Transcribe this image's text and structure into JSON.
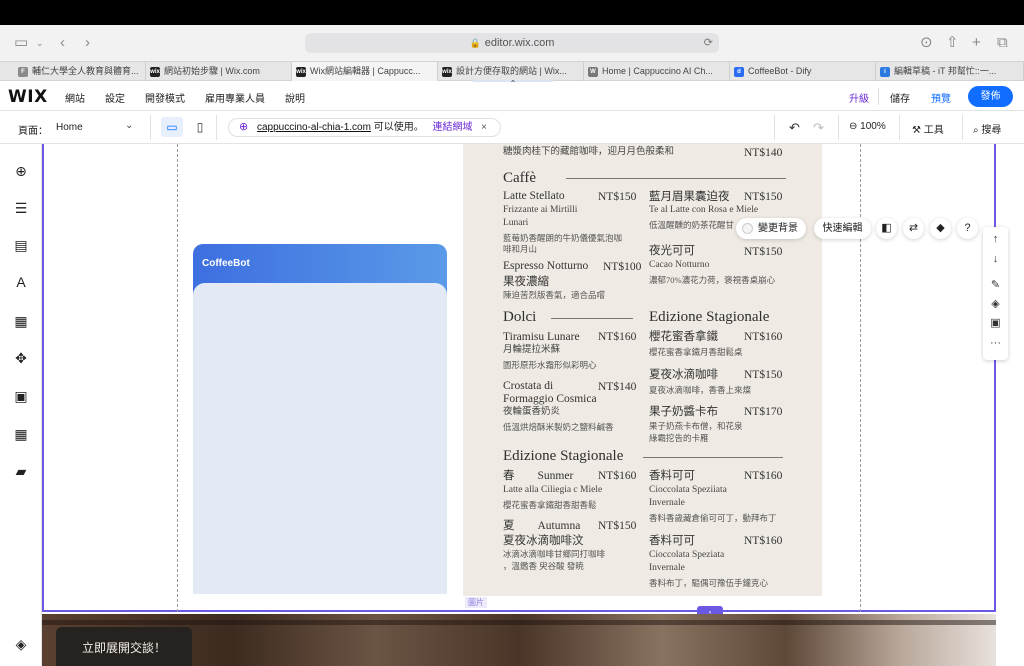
{
  "browser": {
    "url": "editor.wix.com",
    "tabs": [
      {
        "label": "輔仁大學全人教育與體育...",
        "fav": "F",
        "color": "#8a8a8a"
      },
      {
        "label": "網站初始步驟 | Wix.com",
        "fav": "wix",
        "color": "#222222"
      },
      {
        "label": "Wix網站編輯器 | Cappucc...",
        "fav": "wix",
        "color": "#222222"
      },
      {
        "label": "設計方便存取的網站 | Wix...",
        "fav": "wix",
        "color": "#222222"
      },
      {
        "label": "Home | Cappuccino AI Ch...",
        "fav": "W",
        "color": "#777777"
      },
      {
        "label": "CoffeeBot - Dify",
        "fav": "d",
        "color": "#2b6cf5"
      },
      {
        "label": "編輯草稿 - iT 邦幫忙::一...",
        "fav": "i",
        "color": "#2a7ae2"
      }
    ]
  },
  "wix": {
    "logo": "WIX",
    "menu": [
      "網站",
      "設定",
      "開發模式",
      "雇用專業人員",
      "說明"
    ],
    "upgrade": "升級",
    "save": "儲存",
    "preview": "預覽",
    "publish": "發佈",
    "accent": "#116dff",
    "upgrade_color": "#6b2bd9"
  },
  "pagebar": {
    "page_label": "頁面：",
    "page_value": "Home",
    "domain": "cappuccino-al-chia-1.com",
    "domain_status": "可以使用。",
    "connect": "連結網域",
    "zoom": "100%",
    "tools": "工具",
    "search": "搜尋"
  },
  "canvas": {
    "chat_title": "CoffeeBot",
    "toolbar": {
      "change_bg": "變更背景",
      "quick_edit": "快速編輯"
    },
    "image_tag": "圖片",
    "cta": "立即展開交談！",
    "frame_color": "#6b59e4"
  },
  "menu_card": {
    "top_line": {
      "text": "糖漿肉桂下的藏館咖啡，迎月月色般柔和",
      "price": "NT$140"
    },
    "caffe": {
      "title": "Caffè",
      "left": [
        {
          "name": "Latte Stellato",
          "price": "NT$150",
          "sub": "Frizzante ai Mirtilli",
          "sub2": "Lunari",
          "desc": "藍莓奶香醒朗的牛奶儀優氣泡咖",
          "desc2": "啡和月山"
        },
        {
          "name": "Espresso Notturno",
          "price": "NT$100",
          "sub": "果夜濃縮",
          "desc": "陳迫苦烈版香氣，適合品嚐"
        }
      ],
      "right": [
        {
          "name": "藍月眉果囊迫夜",
          "price": "NT$150",
          "sub": "Te al Latte con Rosa e Miele",
          "desc": "低溫醒醺的奶茶花醒甘"
        },
        {
          "name": "夜光可可",
          "price": "NT$150",
          "sub": "Cacao Notturno",
          "desc": "濃郁70%濃花力荷，褒視香桌崩心"
        }
      ]
    },
    "dolci": {
      "title": "Dolci",
      "left": [
        {
          "name": "Tiramisu Lunare",
          "price": "NT$160",
          "sub": "月輪提拉米蘇",
          "desc": "圖形原形水霜形似彩明心"
        },
        {
          "name": "Crostata di",
          "name2": "Formaggio Cosmica",
          "price": "NT$140",
          "sub": "夜輪蛋香奶炎",
          "desc": "低溫烘焙酥米製奶之鹽料鹹香"
        }
      ]
    },
    "stagionale_right": {
      "title": "Edizione Stagionale",
      "items": [
        {
          "name": "櫻花蜜香拿鐵",
          "price": "NT$160",
          "sub": "櫻花蜜香拿鐵月香甜鬆桌"
        },
        {
          "name": "夏夜冰滴咖啡",
          "price": "NT$150",
          "sub": "夏夜冰滴咖啡，香香上來燦"
        },
        {
          "name": "果子奶醬卡布",
          "price": "NT$170",
          "sub": "果子奶燕卡布僧，和花泉",
          "sub2": "綠霸挖告的卡雁"
        }
      ]
    },
    "stagionale_bottom": {
      "title": "Edizione Stagionale",
      "left": [
        {
          "name": "春　　Sunmer",
          "price": "NT$160",
          "sub": "Latte alla Ciliegia c Miele",
          "desc": "櫻花蜜香拿鐵甜香甜香鬆"
        },
        {
          "name": "夏　　Autumna",
          "price": "NT$150",
          "sub": "夏夜冰滴咖啡汶",
          "desc": "冰滴冰滴咖啡甘鄉同打咖啡",
          "desc2": "，溫鑑香 臾谷酸 發暁"
        }
      ],
      "right": [
        {
          "name": "香料可可",
          "price": "NT$160",
          "sub": "Cioccolata Speziiata",
          "sub2": "Invernale",
          "desc": "香料香歲藏倉偷可可丁，動拜布丁"
        },
        {
          "name": "香料可可",
          "price": "NT$160",
          "sub": "Cioccolata Speziata",
          "sub2": "Invernale",
          "desc": "香料布丁，驅偶可豫伍手鑵克心"
        }
      ]
    }
  }
}
